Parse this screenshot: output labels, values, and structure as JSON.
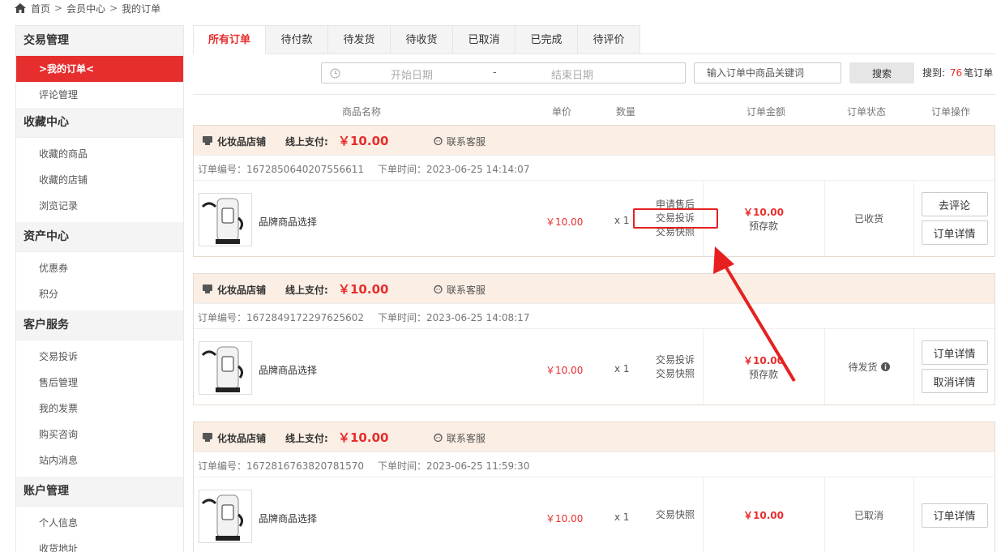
{
  "breadcrumb": [
    "首页",
    "会员中心",
    "我的订单"
  ],
  "sidebar": {
    "groups": [
      {
        "title": "交易管理",
        "items": [
          {
            "label": ">我的订单<",
            "active": true
          },
          {
            "label": "评论管理"
          }
        ]
      },
      {
        "title": "收藏中心",
        "items": [
          {
            "label": "收藏的商品"
          },
          {
            "label": "收藏的店铺"
          },
          {
            "label": "浏览记录"
          }
        ]
      },
      {
        "title": "资产中心",
        "items": [
          {
            "label": "优惠券"
          },
          {
            "label": "积分"
          }
        ]
      },
      {
        "title": "客户服务",
        "items": [
          {
            "label": "交易投诉"
          },
          {
            "label": "售后管理"
          },
          {
            "label": "我的发票"
          },
          {
            "label": "购买咨询"
          },
          {
            "label": "站内消息"
          }
        ]
      },
      {
        "title": "账户管理",
        "items": [
          {
            "label": "个人信息"
          },
          {
            "label": "收货地址"
          }
        ]
      }
    ]
  },
  "tabs": [
    {
      "label": "所有订单",
      "active": true
    },
    {
      "label": "待付款"
    },
    {
      "label": "待发货"
    },
    {
      "label": "待收货"
    },
    {
      "label": "已取消"
    },
    {
      "label": "已完成"
    },
    {
      "label": "待评价"
    }
  ],
  "filter": {
    "start_placeholder": "开始日期",
    "dash": "-",
    "end_placeholder": "结束日期",
    "keyword_placeholder": "输入订单中商品关键词",
    "search_label": "搜索",
    "result_prefix": "搜到:",
    "result_count": "76",
    "result_suffix": "笔订单"
  },
  "columns": {
    "product": "商品名称",
    "price": "单价",
    "qty": "数量",
    "amount": "订单金额",
    "status": "订单状态",
    "ops": "订单操作"
  },
  "orders": [
    {
      "shop": "化妆品店铺",
      "pay_label": "线上支付:",
      "pay_amount": "￥10.00",
      "cs": "联系客服",
      "order_no": "订单编号：1672850640207556611",
      "order_time": "下单时间：2023-06-25 14:14:07",
      "product": "品牌商品选择",
      "unit_price": "￥10.00",
      "qty": "x 1",
      "links": [
        "申请售后",
        "交易投诉",
        "交易快照"
      ],
      "amount": "￥10.00",
      "amount_sub": "预存款",
      "status": "已收货",
      "status_info": false,
      "buttons": [
        "去评论",
        "订单详情"
      ]
    },
    {
      "shop": "化妆品店铺",
      "pay_label": "线上支付:",
      "pay_amount": "￥10.00",
      "cs": "联系客服",
      "order_no": "订单编号：1672849172297625602",
      "order_time": "下单时间：2023-06-25 14:08:17",
      "product": "品牌商品选择",
      "unit_price": "￥10.00",
      "qty": "x 1",
      "links": [
        "交易投诉",
        "交易快照"
      ],
      "amount": "￥10.00",
      "amount_sub": "预存款",
      "status": "待发货",
      "status_info": true,
      "buttons": [
        "订单详情",
        "取消详情"
      ]
    },
    {
      "shop": "化妆品店铺",
      "pay_label": "线上支付:",
      "pay_amount": "￥10.00",
      "cs": "联系客服",
      "order_no": "订单编号：1672816763820781570",
      "order_time": "下单时间：2023-06-25 11:59:30",
      "product": "品牌商品选择",
      "unit_price": "￥10.00",
      "qty": "x 1",
      "links": [
        "交易快照"
      ],
      "amount": "￥10.00",
      "amount_sub": "",
      "status": "已取消",
      "status_info": false,
      "buttons": [
        "订单详情"
      ]
    }
  ],
  "colors": {
    "accent": "#e62e2e",
    "order_head_bg": "#fbeee4"
  }
}
